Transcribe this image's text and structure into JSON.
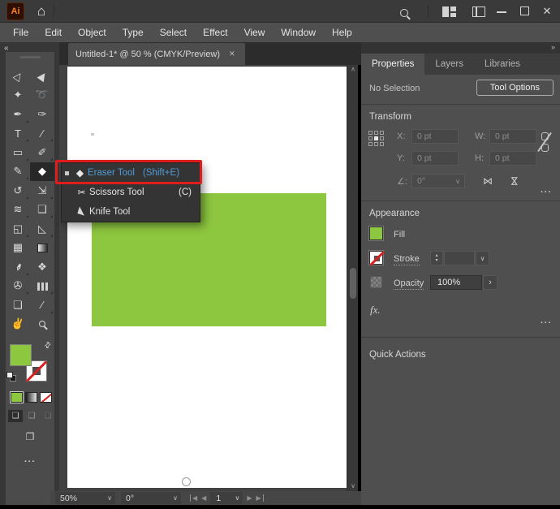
{
  "titlebar": {
    "app_badge": "Ai"
  },
  "icons": {
    "home": "⌂",
    "close": "✕",
    "chevron": "∨",
    "submenu": "›",
    "step_up": "▴",
    "step_down": "▾",
    "flip": "⋈",
    "collapse_left": "«",
    "collapse_right": "»",
    "ellipsis": "···",
    "first_page": "◀",
    "prev_page": "◀",
    "next_page": "▶",
    "last_page": "▶",
    "swap_swatch": "⇄",
    "screen_mode": "❐",
    "draw_mode": "❏"
  },
  "menubar": {
    "items": [
      "File",
      "Edit",
      "Object",
      "Type",
      "Select",
      "Effect",
      "View",
      "Window",
      "Help"
    ]
  },
  "document_tab": {
    "label": "Untitled-1* @ 50 % (CMYK/Preview)"
  },
  "toolbar": {
    "tools": [
      {
        "name": "selection-tool",
        "glyph": "▷",
        "rot": -55
      },
      {
        "name": "direct-selection-tool",
        "glyph": "▶",
        "rot": -55
      },
      {
        "name": "magic-wand-tool",
        "glyph": "✦"
      },
      {
        "name": "lasso-tool",
        "glyph": "➰"
      },
      {
        "name": "pen-tool",
        "glyph": "✒",
        "fly": 1
      },
      {
        "name": "curvature-tool",
        "glyph": "✑"
      },
      {
        "name": "type-tool",
        "glyph": "T",
        "fly": 1
      },
      {
        "name": "line-segment-tool",
        "glyph": "∕",
        "fly": 1
      },
      {
        "name": "rectangle-tool",
        "glyph": "▭",
        "fly": 1
      },
      {
        "name": "paintbrush-tool",
        "glyph": "✐",
        "fly": 1
      },
      {
        "name": "shaper-tool",
        "glyph": "✎",
        "fly": 1
      },
      {
        "name": "eraser-tool",
        "glyph": "◆",
        "selected": 1,
        "fly": 1
      },
      {
        "name": "rotate-tool",
        "glyph": "↺",
        "fly": 1
      },
      {
        "name": "scale-tool",
        "glyph": "⇲",
        "fly": 1
      },
      {
        "name": "width-tool",
        "glyph": "≋",
        "fly": 1
      },
      {
        "name": "free-transform-tool",
        "glyph": "❑",
        "fly": 1
      },
      {
        "name": "shape-builder-tool",
        "glyph": "◱",
        "fly": 1
      },
      {
        "name": "perspective-grid-tool",
        "glyph": "◺",
        "fly": 1
      },
      {
        "name": "mesh-tool",
        "glyph": "▦"
      },
      {
        "name": "gradient-tool",
        "type": "gradient"
      },
      {
        "name": "eyedropper-tool",
        "glyph": "✒",
        "rot": 115,
        "fly": 1
      },
      {
        "name": "blend-tool",
        "glyph": "❖"
      },
      {
        "name": "symbol-sprayer-tool",
        "glyph": "✇",
        "fly": 1
      },
      {
        "name": "column-graph-tool",
        "type": "graph",
        "fly": 1
      },
      {
        "name": "artboard-tool",
        "glyph": "❏"
      },
      {
        "name": "slice-tool",
        "glyph": "∕",
        "fly": 1
      },
      {
        "name": "hand-tool",
        "glyph": "✌",
        "rot": 10
      },
      {
        "name": "zoom-tool",
        "type": "zoom"
      }
    ]
  },
  "flyout": {
    "items": [
      {
        "name": "eraser-tool-item",
        "icon": "eraser",
        "label": "Eraser Tool",
        "shortcut": "(Shift+E)",
        "active": true
      },
      {
        "name": "scissors-tool-item",
        "icon": "scissors",
        "label": "Scissors Tool",
        "shortcut": "(C)"
      },
      {
        "name": "knife-tool-item",
        "icon": "knife",
        "label": "Knife Tool",
        "shortcut": ""
      }
    ],
    "icon_glyphs": {
      "eraser": "◆",
      "scissors": "✂"
    }
  },
  "right_panel": {
    "tabs": [
      {
        "label": "Properties",
        "active": true
      },
      {
        "label": "Layers"
      },
      {
        "label": "Libraries"
      }
    ],
    "selection_status": "No Selection",
    "tool_options_label": "Tool Options",
    "transform": {
      "title": "Transform",
      "x_label": "X:",
      "y_label": "Y:",
      "w_label": "W:",
      "h_label": "H:",
      "x_placeholder": "0 pt",
      "y_placeholder": "0 pt",
      "w_placeholder": "0 pt",
      "h_placeholder": "0 pt",
      "angle_label": "∠:",
      "angle_value": "0°"
    },
    "appearance": {
      "title": "Appearance",
      "fill_label": "Fill",
      "stroke_label": "Stroke",
      "opacity_label": "Opacity",
      "opacity_value": "100%",
      "fx_label": "fx."
    },
    "quick_actions": {
      "title": "Quick Actions"
    }
  },
  "statusbar": {
    "zoom": "50%",
    "rotation": "0°",
    "page": "1"
  },
  "colors": {
    "green": "#8dc63f",
    "annotation_red": "#e01d1d",
    "highlight_blue": "#4f9ed9"
  }
}
